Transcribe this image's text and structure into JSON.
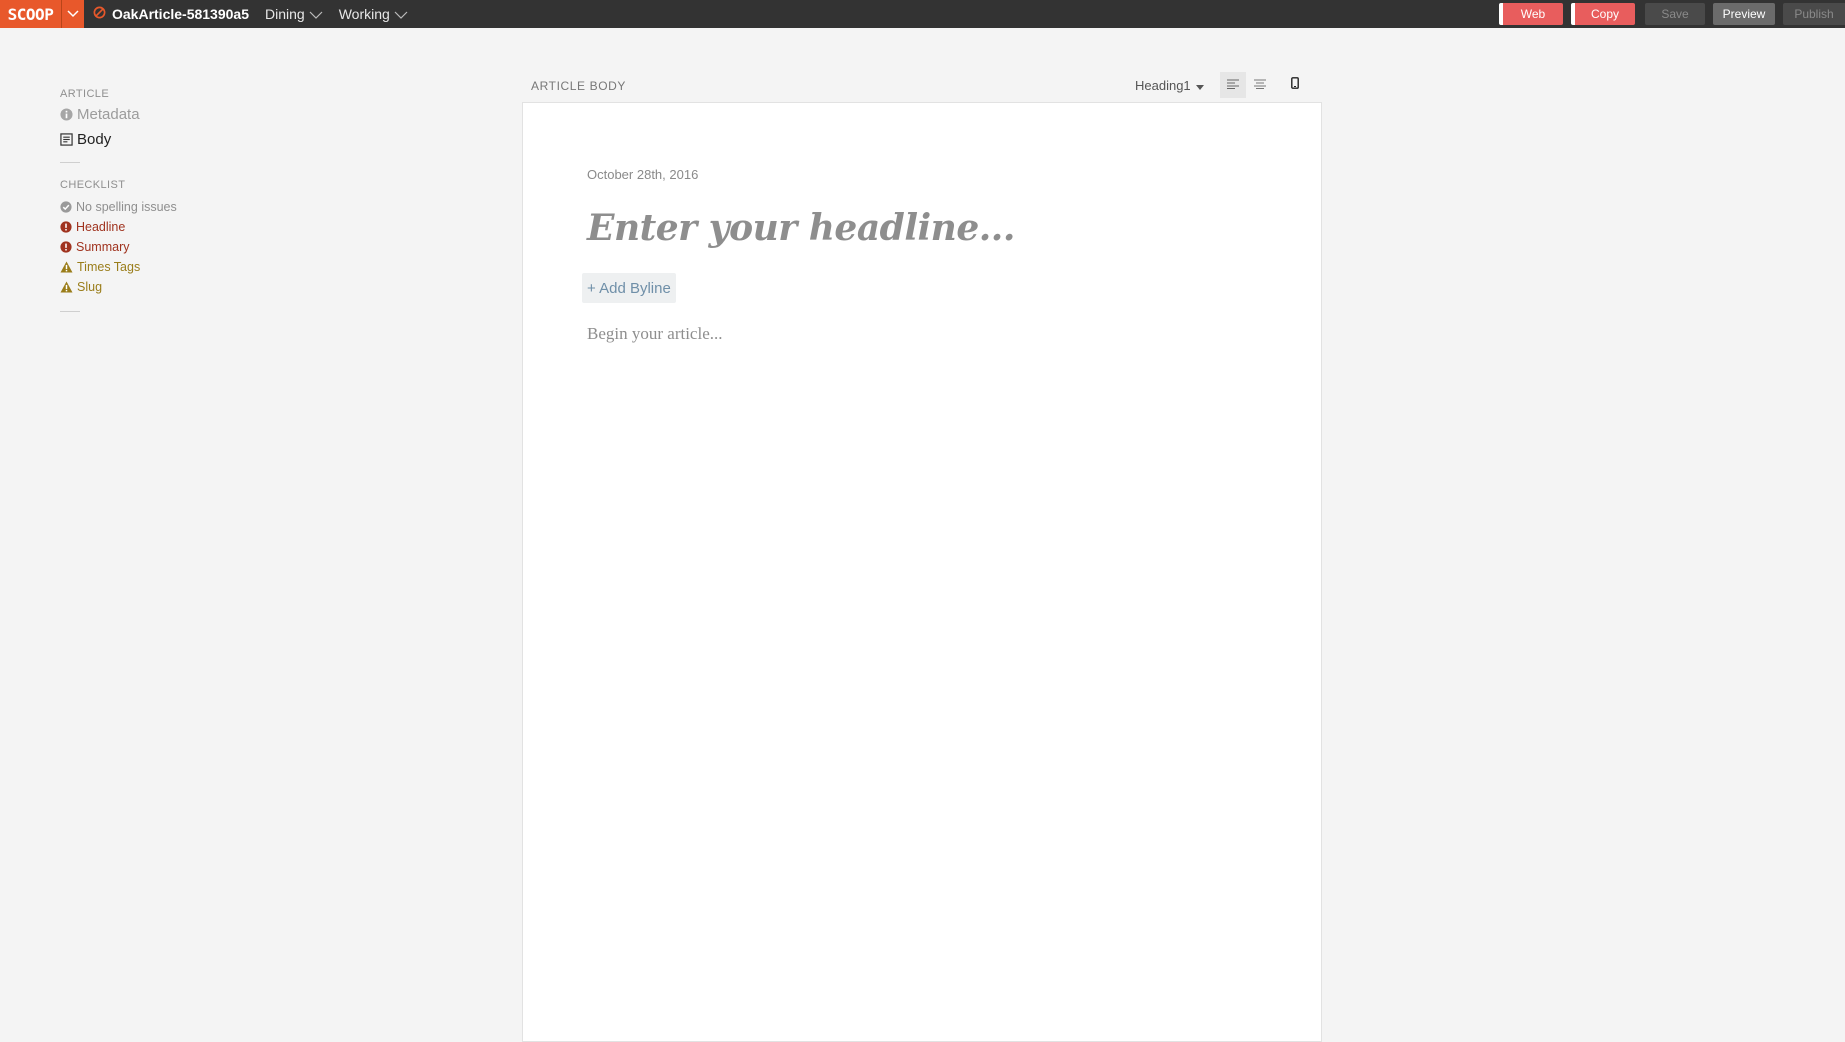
{
  "topbar": {
    "logo": "SCOOP",
    "article_id": "OakArticle-581390a5",
    "section": "Dining",
    "status": "Working",
    "buttons": {
      "web": "Web",
      "copy": "Copy",
      "save": "Save",
      "preview": "Preview",
      "publish": "Publish"
    }
  },
  "sidebar": {
    "article_heading": "ARTICLE",
    "links": {
      "metadata": "Metadata",
      "body": "Body"
    },
    "checklist_heading": "CHECKLIST",
    "checklist": {
      "spelling": "No spelling issues",
      "headline": "Headline",
      "summary": "Summary",
      "times_tags": "Times Tags",
      "slug": "Slug"
    }
  },
  "editor": {
    "label": "ARTICLE BODY",
    "text_style": "Heading1",
    "date": "October 28th, 2016",
    "headline_placeholder": "Enter your headline...",
    "byline_button": "+ Add Byline",
    "body_placeholder": "Begin your article..."
  },
  "colors": {
    "brand": "#e8582b",
    "topbar": "#333333",
    "error": "#a0331f",
    "warning": "#9a7d1a",
    "web_copy_button": "#e85d5d"
  }
}
